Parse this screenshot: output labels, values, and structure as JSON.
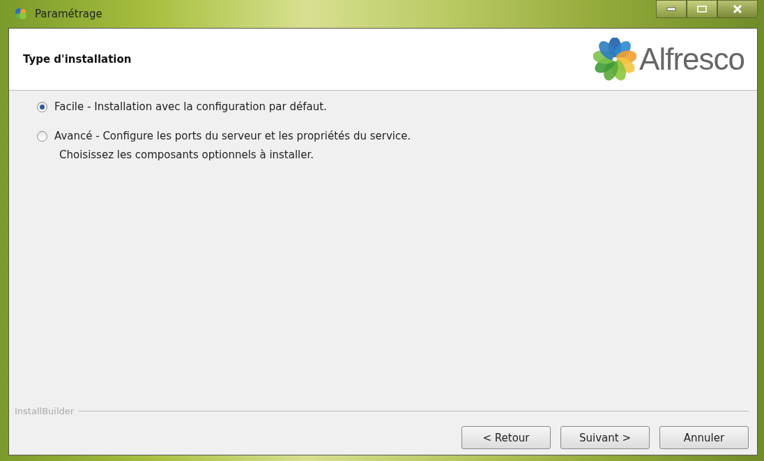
{
  "window": {
    "title": "Paramétrage"
  },
  "header": {
    "title": "Type d'installation",
    "logo_text": "Alfresco"
  },
  "options": [
    {
      "label": "Facile - Installation avec la configuration par défaut.",
      "selected": true
    },
    {
      "label": "Avancé - Configure les ports du serveur et les propriétés du service.",
      "detail": "Choisissez les composants optionnels à installer.",
      "selected": false
    }
  ],
  "footer": {
    "brand": "InstallBuilder"
  },
  "buttons": [
    "< Retour",
    "Suivant >",
    "Annuler"
  ]
}
